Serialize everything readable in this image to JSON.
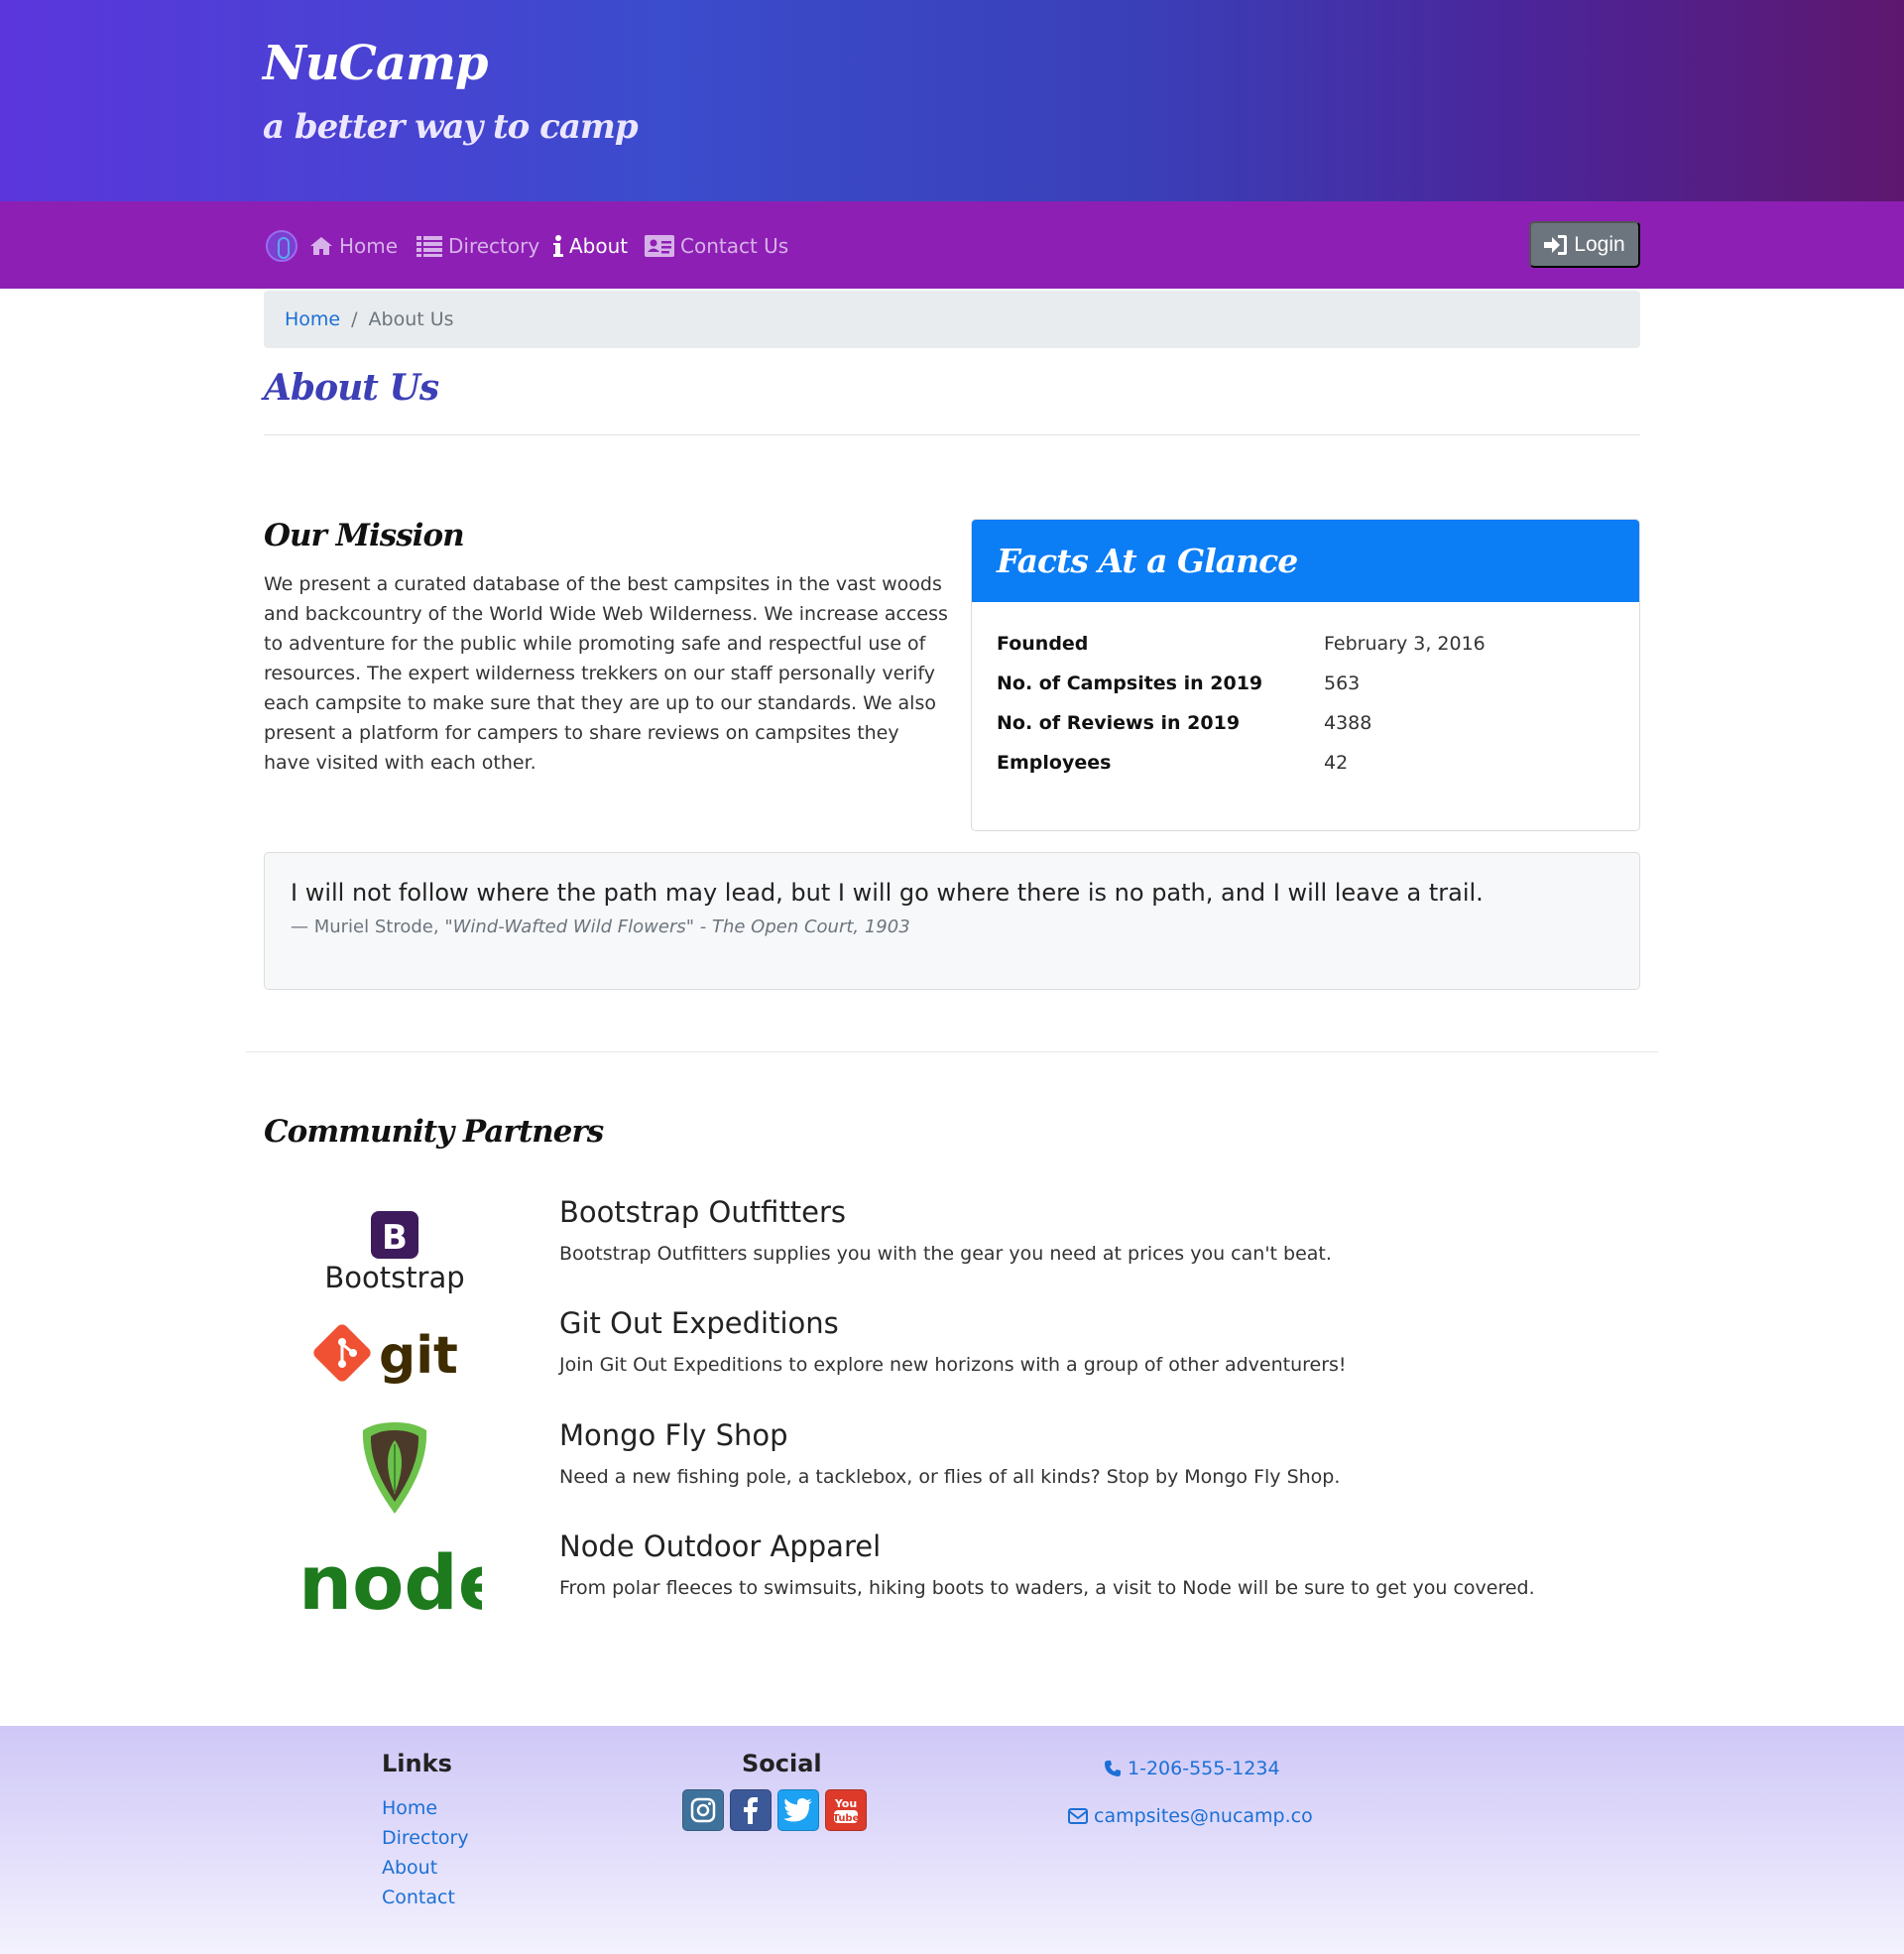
{
  "header": {
    "title": "NuCamp",
    "subtitle": "a better way to camp"
  },
  "nav": {
    "items": [
      {
        "label": "Home",
        "icon": "home-icon"
      },
      {
        "label": "Directory",
        "icon": "list-icon"
      },
      {
        "label": "About",
        "icon": "info-icon"
      },
      {
        "label": "Contact Us",
        "icon": "address-card-icon"
      }
    ],
    "active": "About",
    "login_label": "Login"
  },
  "breadcrumb": {
    "home": "Home",
    "current": "About Us"
  },
  "page_title": "About Us",
  "mission": {
    "title": "Our Mission",
    "text": "We present a curated database of the best campsites in the vast woods and backcountry of the World Wide Web Wilderness. We increase access to adventure for the public while promoting safe and respectful use of resources. The expert wilderness trekkers on our staff personally verify each campsite to make sure that they are up to our standards. We also present a platform for campers to share reviews on campsites they have visited with each other."
  },
  "facts": {
    "title": "Facts At a Glance",
    "rows": [
      {
        "term": "Founded",
        "value": "February 3, 2016"
      },
      {
        "term": "No. of Campsites in 2019",
        "value": "563"
      },
      {
        "term": "No. of Reviews in 2019",
        "value": "4388"
      },
      {
        "term": "Employees",
        "value": "42"
      }
    ]
  },
  "quote": {
    "text": "I will not follow where the path may lead, but I will go where there is no path, and I will leave a trail.",
    "author": "— Muriel Strode, ",
    "cite": "\"Wind-Wafted Wild Flowers\" - The Open Court, 1903"
  },
  "partners": {
    "title": "Community Partners",
    "items": [
      {
        "name": "Bootstrap Outfitters",
        "desc": "Bootstrap Outfitters supplies you with the gear you need at prices you can't beat.",
        "logo_text": "Bootstrap"
      },
      {
        "name": "Git Out Expeditions",
        "desc": "Join Git Out Expeditions to explore new horizons with a group of other adventurers!",
        "logo_text": "git"
      },
      {
        "name": "Mongo Fly Shop",
        "desc": "Need a new fishing pole, a tacklebox, or flies of all kinds? Stop by Mongo Fly Shop."
      },
      {
        "name": "Node Outdoor Apparel",
        "desc": "From polar fleeces to swimsuits, hiking boots to waders, a visit to Node will be sure to get you covered.",
        "logo_text": "node"
      }
    ]
  },
  "footer": {
    "links_title": "Links",
    "links": [
      "Home",
      "Directory",
      "About",
      "Contact"
    ],
    "social_title": "Social",
    "social": [
      "instagram-icon",
      "facebook-icon",
      "twitter-icon",
      "youtube-icon"
    ],
    "phone": "1-206-555-1234",
    "email": "campsites@nucamp.co"
  },
  "colors": {
    "navbar": "#8e1fb4",
    "accent_blue": "#0b7df5",
    "link": "#1b6fd6"
  }
}
